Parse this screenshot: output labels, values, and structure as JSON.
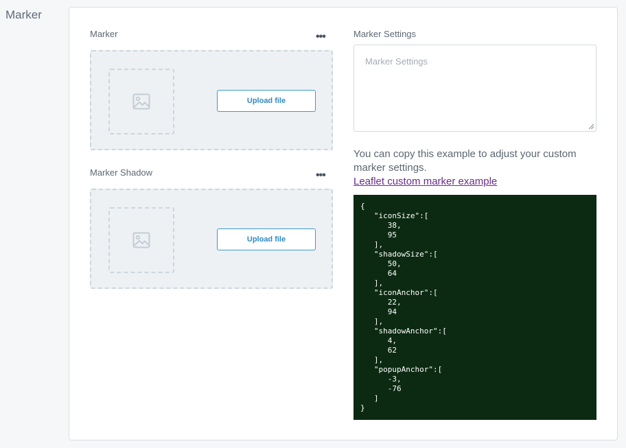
{
  "section_title": "Marker",
  "marker": {
    "label": "Marker",
    "menu_glyph": "•••",
    "upload_label": "Upload file",
    "icon": "image-placeholder-icon"
  },
  "marker_shadow": {
    "label": "Marker Shadow",
    "menu_glyph": "•••",
    "upload_label": "Upload file",
    "icon": "image-placeholder-icon"
  },
  "marker_settings": {
    "label": "Marker Settings",
    "placeholder": "Marker Settings"
  },
  "help": {
    "text": "You can copy this example to adjust your custom marker settings.",
    "link_text": "Leaflet custom marker example"
  },
  "code_lines": [
    "{",
    "   \"iconSize\":[",
    "      38,",
    "      95",
    "   ],",
    "   \"shadowSize\":[",
    "      50,",
    "      64",
    "   ],",
    "   \"iconAnchor\":[",
    "      22,",
    "      94",
    "   ],",
    "   \"shadowAnchor\":[",
    "      4,",
    "      62",
    "   ],",
    "   \"popupAnchor\":[",
    "      -3,",
    "      -76",
    "   ]",
    "}"
  ],
  "colors": {
    "accent": "#3a98d0",
    "code_background": "#0c2a12",
    "link": "#6a2c8e"
  }
}
